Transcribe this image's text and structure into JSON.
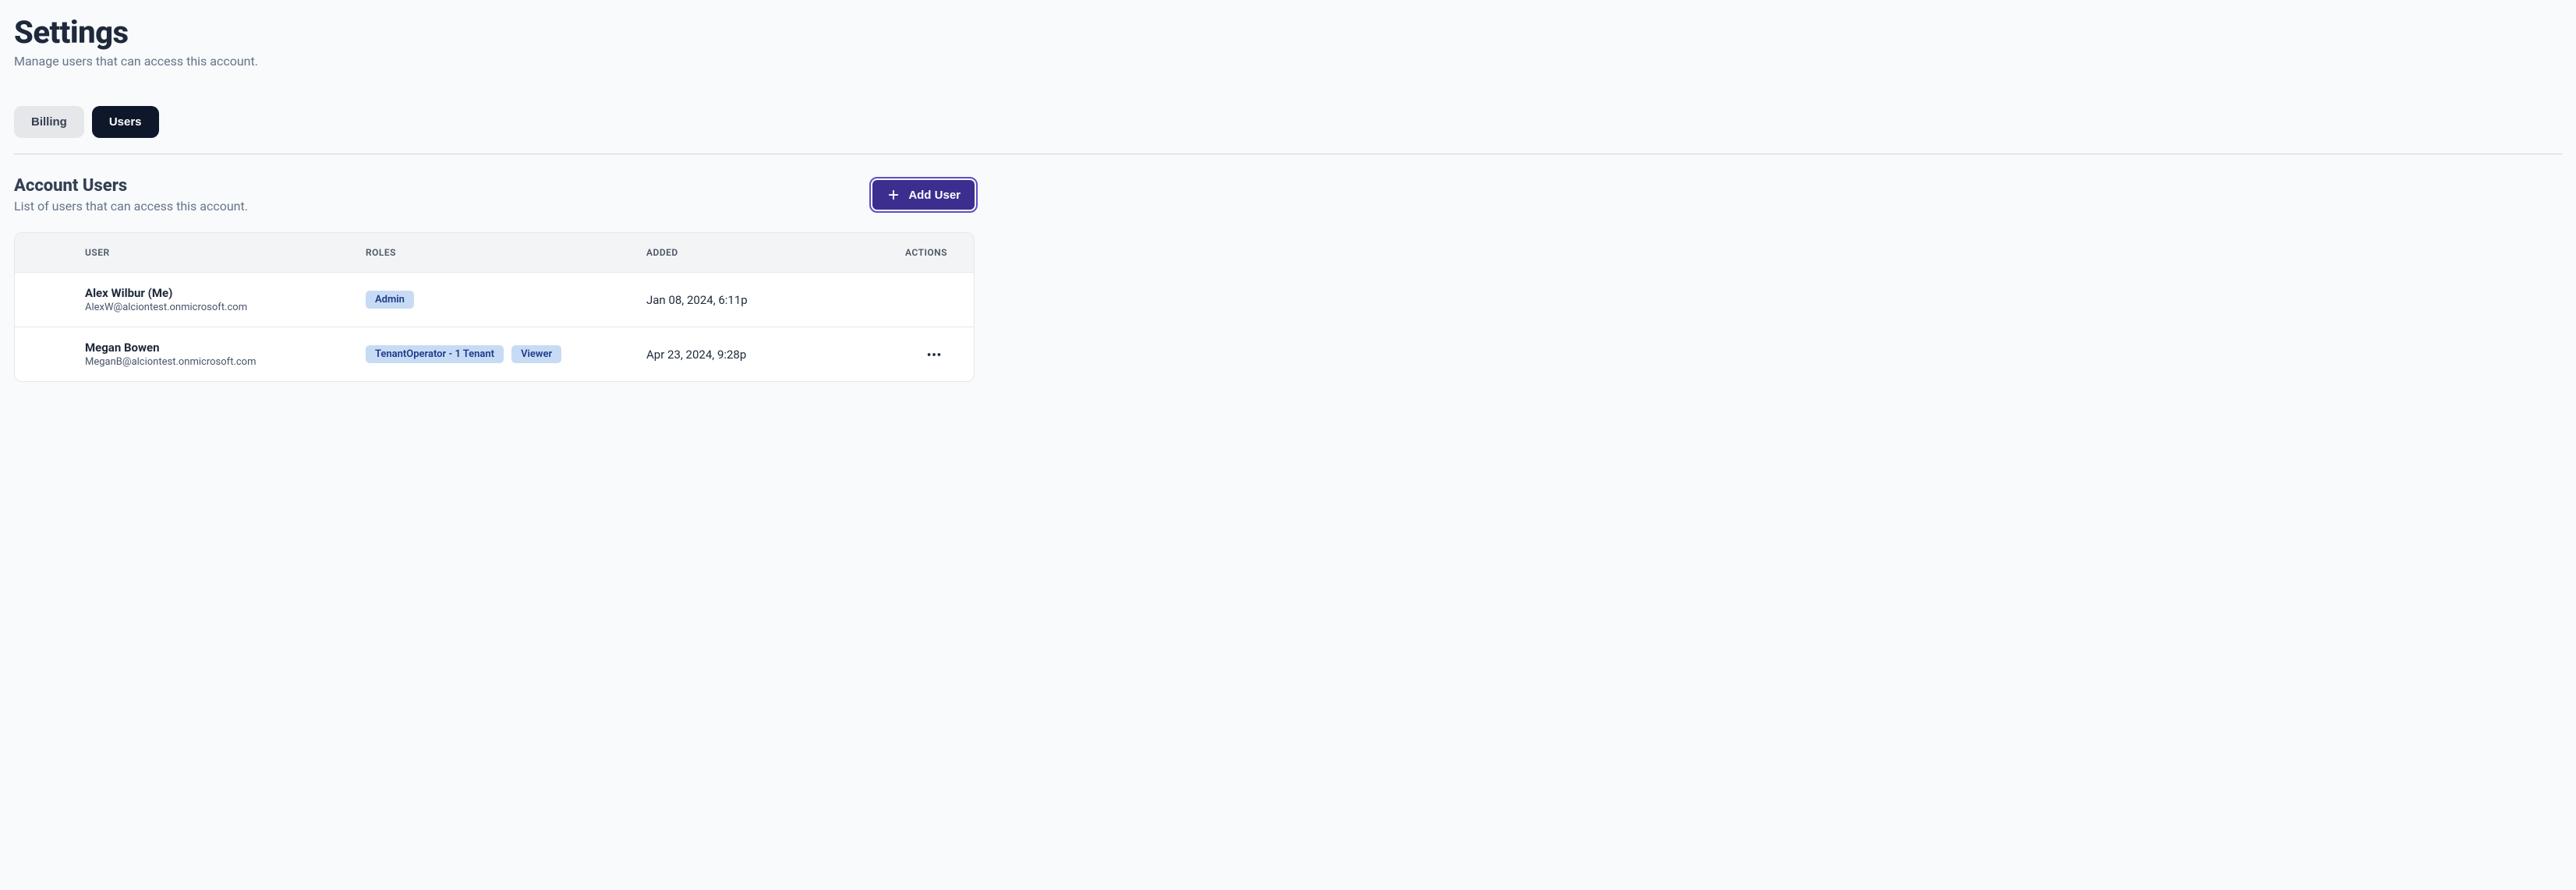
{
  "header": {
    "title": "Settings",
    "subtitle": "Manage users that can access this account."
  },
  "tabs": {
    "billing": "Billing",
    "users": "Users"
  },
  "section": {
    "title": "Account Users",
    "subtitle": "List of users that can access this account.",
    "add_user_label": "Add User"
  },
  "table": {
    "columns": {
      "user": "USER",
      "roles": "ROLES",
      "added": "ADDED",
      "actions": "ACTIONS"
    },
    "rows": [
      {
        "name": "Alex Wilbur (Me)",
        "email": "AlexW@alciontest.onmicrosoft.com",
        "roles": [
          "Admin"
        ],
        "added": "Jan 08, 2024, 6:11p",
        "has_actions": false
      },
      {
        "name": "Megan Bowen",
        "email": "MeganB@alciontest.onmicrosoft.com",
        "roles": [
          "TenantOperator - 1 Tenant",
          "Viewer"
        ],
        "added": "Apr 23, 2024, 9:28p",
        "has_actions": true
      }
    ]
  }
}
